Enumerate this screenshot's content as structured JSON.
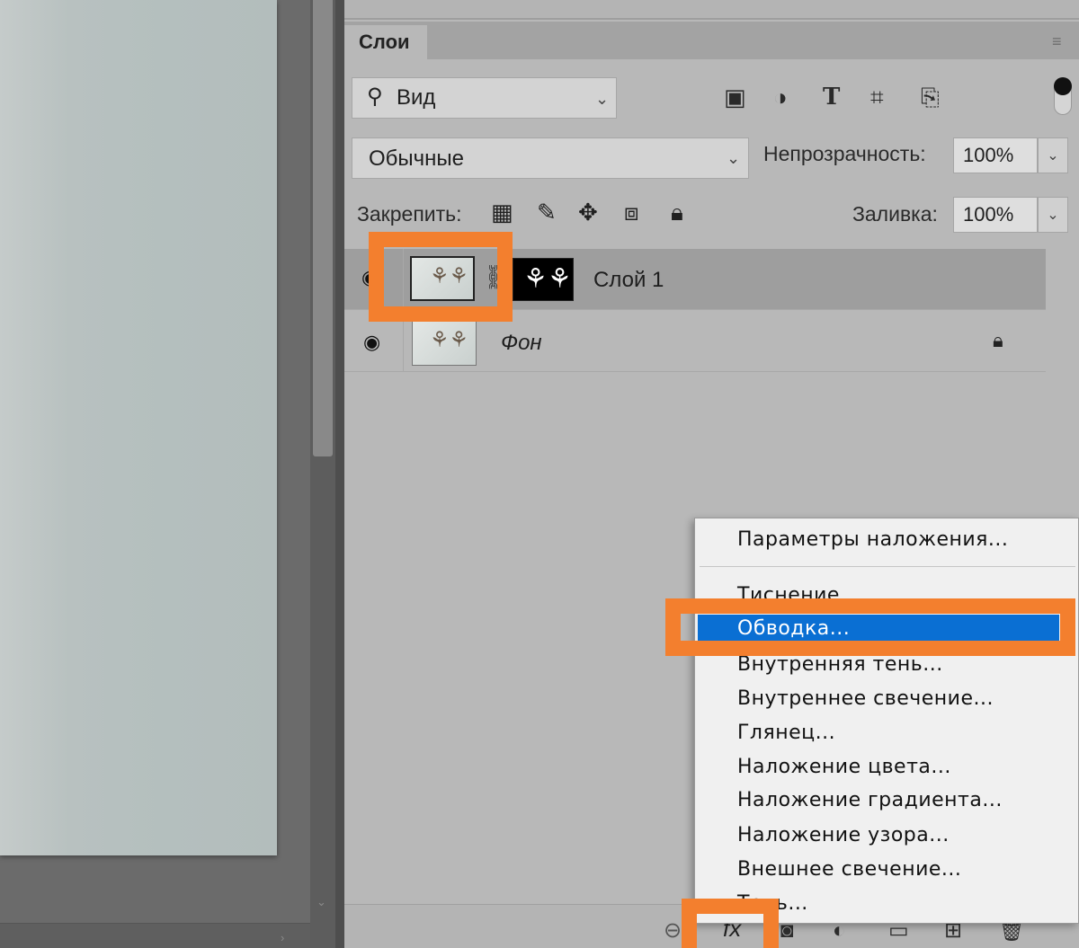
{
  "panel": {
    "tab_label": "Слои",
    "menu_icon": "panel-menu-icon"
  },
  "filter": {
    "kind_label": "Вид",
    "icons": [
      "pixel-layer-icon",
      "adjustment-layer-icon",
      "type-layer-icon",
      "shape-layer-icon",
      "smart-object-icon"
    ]
  },
  "blend": {
    "mode": "Обычные",
    "opacity_label": "Непрозрачность:",
    "opacity_value": "100%"
  },
  "lock": {
    "label": "Закрепить:",
    "fill_label": "Заливка:",
    "fill_value": "100%",
    "icons": [
      "lock-transparent-icon",
      "lock-image-icon",
      "lock-position-icon",
      "lock-artboard-icon",
      "lock-all-icon"
    ]
  },
  "layers": [
    {
      "name": "Слой 1",
      "selected": true,
      "has_mask": true
    },
    {
      "name": "Фон",
      "selected": false,
      "locked": true
    }
  ],
  "context_menu": {
    "items": [
      "Параметры наложения...",
      "Тиснение...",
      "Обводка...",
      "Внутренняя тень...",
      "Внутреннее свечение...",
      "Глянец...",
      "Наложение цвета...",
      "Наложение градиента...",
      "Наложение узора...",
      "Внешнее свечение...",
      "Тень..."
    ],
    "highlighted": "Обводка..."
  },
  "toolbar": {
    "fx_label": "fx",
    "icons": [
      "link-layers-icon",
      "add-style-icon",
      "add-mask-icon",
      "new-adjustment-icon",
      "new-group-icon",
      "new-layer-icon",
      "delete-layer-icon"
    ]
  },
  "colors": {
    "annotation": "#f37f2e",
    "menu_highlight": "#0a6fd3"
  }
}
